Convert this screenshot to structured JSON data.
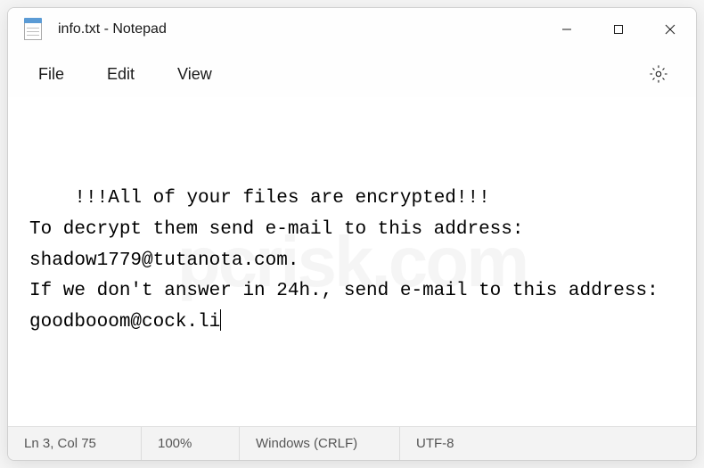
{
  "titlebar": {
    "title": "info.txt - Notepad"
  },
  "menubar": {
    "file": "File",
    "edit": "Edit",
    "view": "View"
  },
  "content": {
    "text": "!!!All of your files are encrypted!!!\nTo decrypt them send e-mail to this address: shadow1779@tutanota.com.\nIf we don't answer in 24h., send e-mail to this address: goodbooom@cock.li"
  },
  "statusbar": {
    "cursor_position": "Ln 3, Col 75",
    "zoom": "100%",
    "line_ending": "Windows (CRLF)",
    "encoding": "UTF-8"
  },
  "watermark": "pcrisk.com"
}
